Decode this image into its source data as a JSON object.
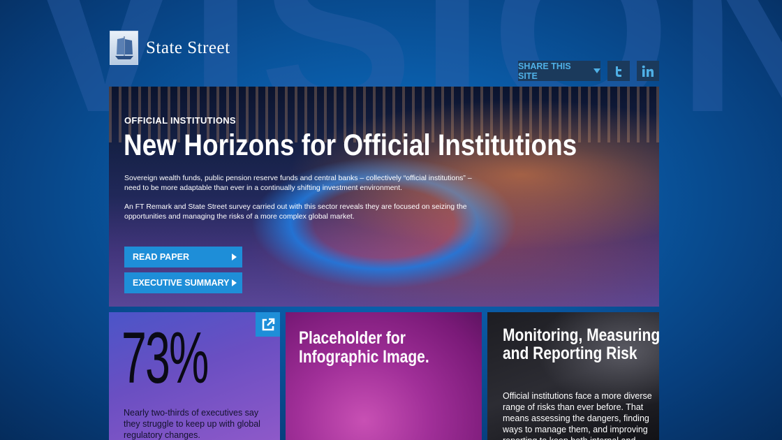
{
  "background": {
    "watermark": "VISION"
  },
  "brand": {
    "name": "State Street",
    "logo_icon": "clipper-ship-icon"
  },
  "share": {
    "label": "SHARE THIS SITE",
    "twitter_icon": "twitter-icon",
    "linkedin_icon": "linkedin-icon"
  },
  "hero": {
    "kicker": "OFFICIAL INSTITUTIONS",
    "title": "New Horizons for Official Institutions",
    "paragraph1": "Sovereign wealth funds, public pension reserve funds and central banks – collectively “official institutions” – need to be more adaptable than ever in a continually shifting investment environment.",
    "paragraph2": "An FT Remark and State Street survey carried out with this sector reveals they are focused on seizing the opportunities and managing the risks of a more complex global market.",
    "read_paper": "READ PAPER",
    "exec_summary": "EXECUTIVE SUMMARY"
  },
  "cards": {
    "stat": {
      "value": "73%",
      "text": "Nearly two-thirds of executives say they struggle to keep up with global regulatory changes."
    },
    "infographic": {
      "title": "Placeholder for Infographic Image."
    },
    "risk": {
      "title": "Monitoring, Measuring and Reporting Risk",
      "text": "Official institutions face a more diverse range of risks than ever before. That means assessing the dangers, finding ways to manage them, and improving reporting to keep both internal and"
    }
  },
  "colors": {
    "accent": "#1e8ed8",
    "share_bg": "#1b3a5c",
    "share_text": "#4fb0e6"
  }
}
